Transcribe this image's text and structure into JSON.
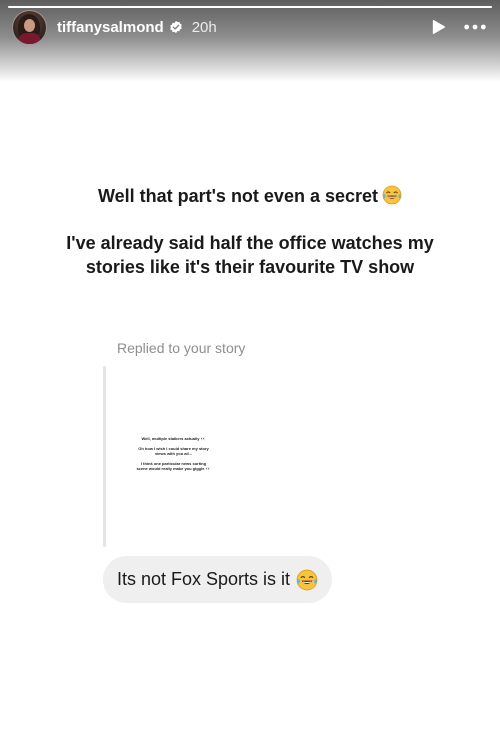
{
  "header": {
    "username": "tiffanysalmond",
    "time": "20h",
    "progress_fraction": 1.0
  },
  "caption": {
    "line1": "Well that part's not even a secret",
    "line2a": "I've already said half the office watches my",
    "line2b": "stories like it's their favourite TV show"
  },
  "reply": {
    "label": "Replied to your story",
    "thumbnail_lines": [
      "Well, multiple stalkers actually 👀",
      "Oh how I wish I could share my story",
      "views with you all...",
      "I think one particular news sorting",
      "scene would really make you giggle 👀"
    ]
  },
  "message": {
    "text": "Its not Fox Sports is it"
  },
  "icons": {
    "verified": "verified-badge-icon",
    "play": "play-icon",
    "more": "more-options-icon",
    "emoji": "laughing-tears-emoji"
  },
  "colors": {
    "verified_blue": "#ffffff",
    "bubble_bg": "#efefef",
    "label_gray": "#8e8e8e"
  }
}
